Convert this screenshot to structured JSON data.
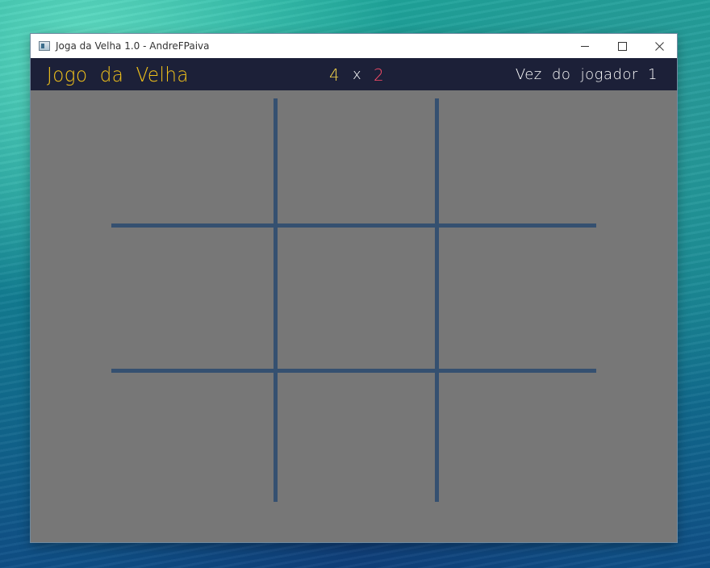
{
  "window": {
    "title": "Joga da Velha 1.0 - AndreFPaiva"
  },
  "header": {
    "game_title": "Jogo da Velha",
    "score": {
      "player1": "4",
      "separator": "x",
      "player2": "2"
    },
    "turn_text": "Vez do jogador 1"
  },
  "board": {
    "cells": [
      "",
      "",
      "",
      "",
      "",
      "",
      "",
      "",
      ""
    ]
  },
  "colors": {
    "header_bg": "#1c2038",
    "board_bg": "#777777",
    "grid_line": "#355070",
    "title_color": "#f2c21a",
    "player1_color": "#f4d44a",
    "player2_color": "#ff4d6a"
  },
  "icons": {
    "app": "app-icon",
    "minimize": "minimize-icon",
    "maximize": "maximize-icon",
    "close": "close-icon"
  }
}
